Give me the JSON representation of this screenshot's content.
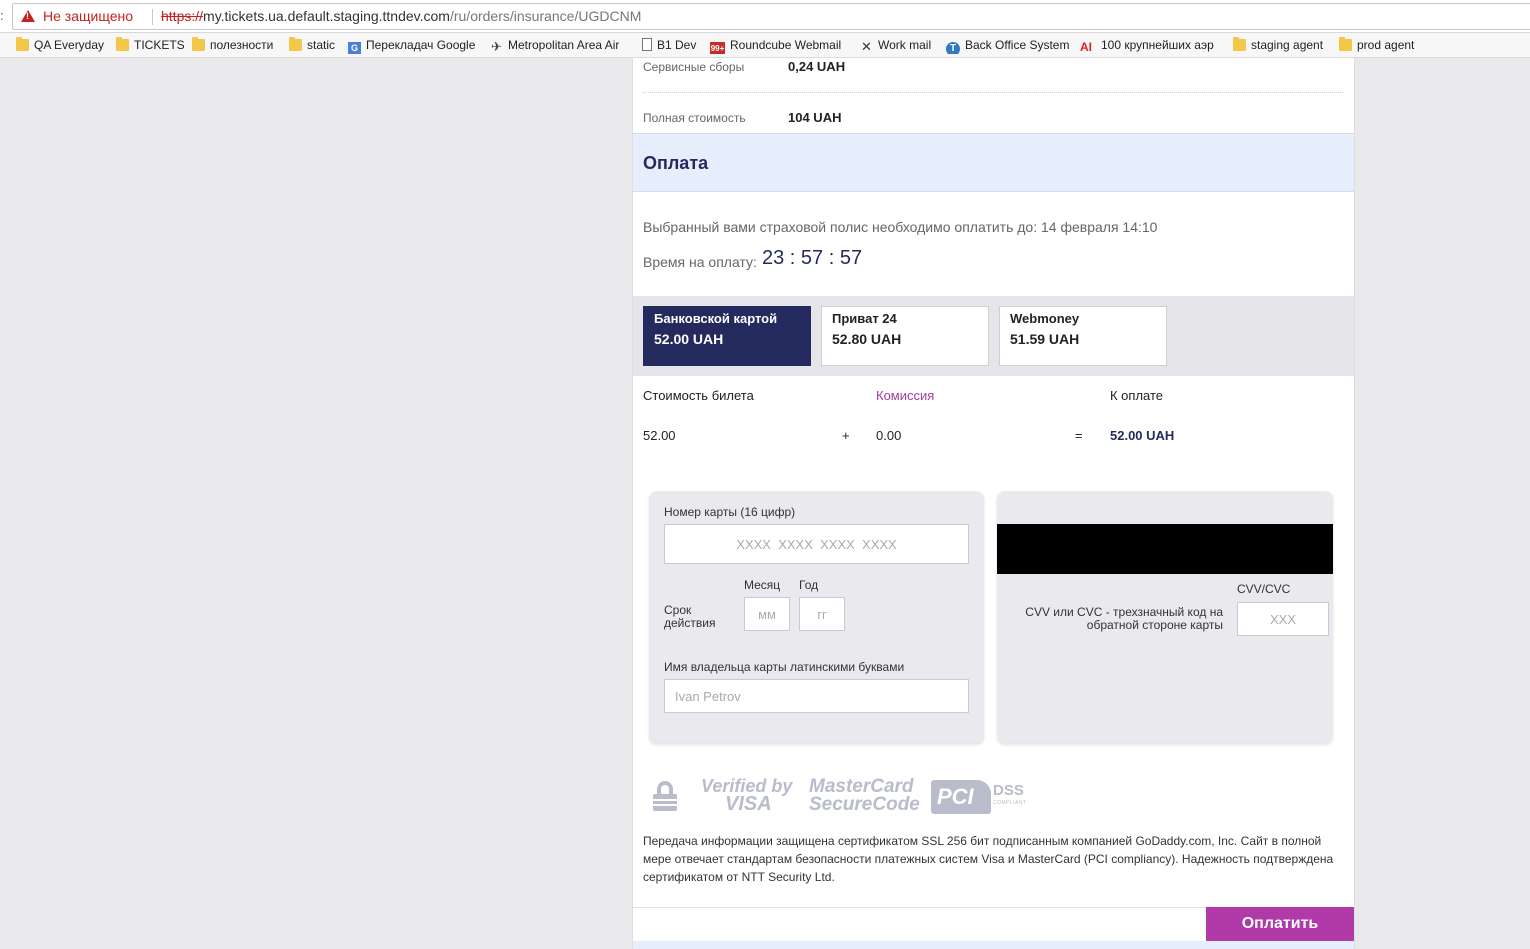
{
  "browser": {
    "left_edge_glyph": ":",
    "security_label": "Не защищено",
    "url_scheme": "https://",
    "url_host": "my.tickets.ua.default.staging.ttndev.com",
    "url_path": "/ru/orders/insurance/UGDCNM"
  },
  "bookmarks": [
    {
      "label": "QA Everyday",
      "icon": "folder-icon"
    },
    {
      "label": "TICKETS",
      "icon": "folder-icon"
    },
    {
      "label": "полезности",
      "icon": "folder-icon"
    },
    {
      "label": "static",
      "icon": "folder-icon"
    },
    {
      "label": "Перекладач Google",
      "icon": "google-translate-icon"
    },
    {
      "label": "Metropolitan Area Air",
      "icon": "plane-icon"
    },
    {
      "label": "B1 Dev",
      "icon": "page-icon"
    },
    {
      "label": "Roundcube Webmail",
      "icon": "roundcube-icon"
    },
    {
      "label": "Work mail",
      "icon": "mail-icon"
    },
    {
      "label": "Back Office System",
      "icon": "back-office-icon"
    },
    {
      "label": "100 крупнейших аэр",
      "icon": "ai-icon"
    },
    {
      "label": "staging agent",
      "icon": "folder-icon"
    },
    {
      "label": "prod agent",
      "icon": "folder-icon"
    }
  ],
  "summary": {
    "service_fee_label": "Сервисные сборы",
    "service_fee_value": "0,24 UAH",
    "total_label": "Полная стоимость",
    "total_value": "104 UAH"
  },
  "payment": {
    "title": "Оплата",
    "deadline_text": "Выбранный вами страховой полис необходимо оплатить до: 14 февраля 14:10",
    "timer_label": "Время на оплату:",
    "timer_value": "23 : 57 : 57",
    "methods": [
      {
        "name": "Банковской картой",
        "price": "52.00 UAH",
        "active": true
      },
      {
        "name": "Приват 24",
        "price": "52.80 UAH",
        "active": false
      },
      {
        "name": "Webmoney",
        "price": "51.59 UAH",
        "active": false
      }
    ],
    "calc": {
      "ticket_cost_label": "Стоимость билета",
      "commission_label": "Комиссия",
      "to_pay_label": "К оплате",
      "ticket_cost_value": "52.00",
      "plus": "+",
      "commission_value": "0.00",
      "equals": "=",
      "to_pay_value": "52.00 UAH"
    },
    "card": {
      "number_label": "Номер карты (16 цифр)",
      "number_placeholder": "XXXX  XXXX  XXXX  XXXX",
      "validity_label": "Срок действия",
      "month_label": "Месяц",
      "year_label": "Год",
      "month_placeholder": "мм",
      "year_placeholder": "гг",
      "holder_label": "Имя владельца карты латинскими буквами",
      "holder_placeholder": "Ivan Petrov",
      "cvv_label": "CVV/CVC",
      "cvv_hint": "CVV или CVC - трехзначный код на обратной стороне карты",
      "cvv_placeholder": "XXX"
    },
    "logos": {
      "verified_by": "Verified by",
      "visa": "VISA",
      "mastercard": "MasterCard",
      "securecode": "SecureCode",
      "pci": "PCI",
      "dss": "DSS",
      "compliant": "COMPLIANT"
    },
    "security_text": "Передача информации защищена сертификатом SSL 256 бит подписанным компанией GoDaddy.com, Inc. Сайт в полной мере отвечает стандартам безопасности платежных систем Visa и MasterCard (PCI compliancy). Надежность подтверждена сертификатом от NTT Security Ltd.",
    "pay_button": "Оплатить"
  },
  "colors": {
    "accent_dark": "#242a5e",
    "pay_button": "#b13aa9",
    "commission": "#a23d9a",
    "warning": "#c5221f"
  }
}
